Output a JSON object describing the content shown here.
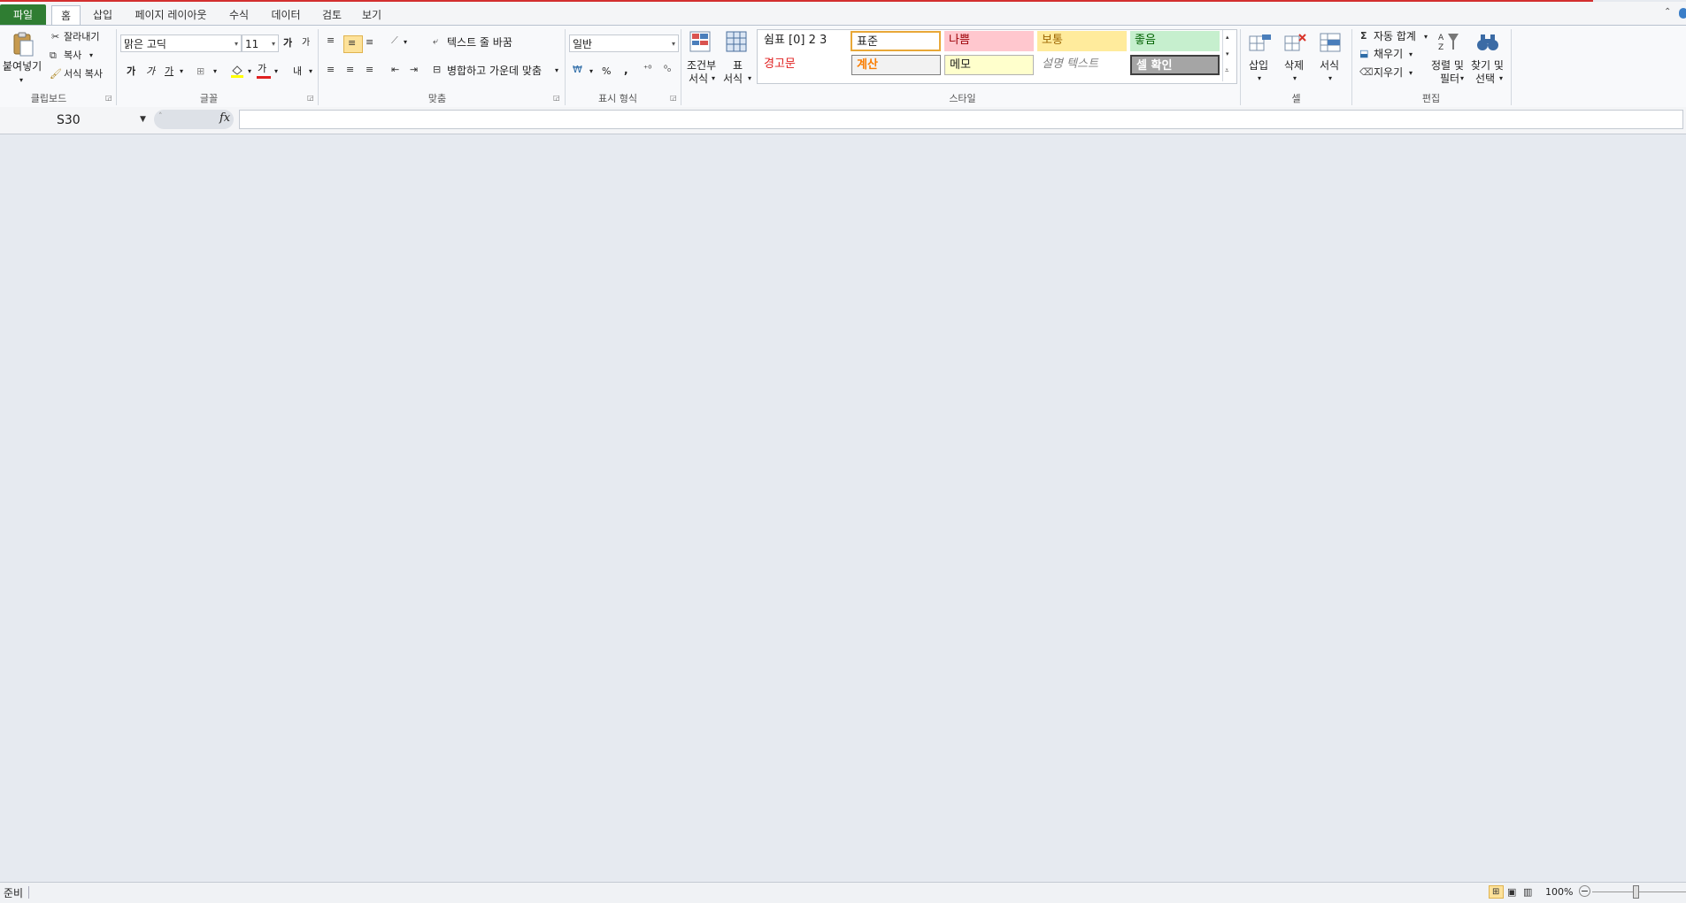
{
  "tabs": {
    "file": "파일",
    "home": "홈",
    "insert": "삽입",
    "page_layout": "페이지 레이아웃",
    "formulas": "수식",
    "data": "데이터",
    "review": "검토",
    "view": "보기"
  },
  "clipboard": {
    "paste": "붙여넣기",
    "cut": "잘라내기",
    "copy": "복사",
    "format_painter": "서식 복사",
    "group_label": "클립보드"
  },
  "font": {
    "name": "맑은 고딕",
    "size": "11",
    "grow": "가",
    "shrink": "가",
    "bold": "가",
    "italic": "가",
    "underline": "가",
    "font_color_glyph": "가",
    "phonetic_glyph": "내",
    "group_label": "글꼴"
  },
  "alignment": {
    "wrap_text": "텍스트 줄 바꿈",
    "merge_center": "병합하고 가운데 맞춤",
    "group_label": "맞춤"
  },
  "number": {
    "format": "일반",
    "percent": "%",
    "comma": ",",
    "group_label": "표시 형식"
  },
  "styles": {
    "conditional_line1": "조건부",
    "conditional_line2": "서식",
    "table_line1": "표",
    "table_line2": "서식",
    "comma0": "쉼표 [0] 2 3",
    "normal": "표준",
    "bad": "나쁨",
    "neutral": "보통",
    "good": "좋음",
    "warning": "경고문",
    "calculation": "계산",
    "note": "메모",
    "explanatory": "설명 텍스트",
    "check_cell": "셀 확인",
    "group_label": "스타일"
  },
  "cells": {
    "insert": "삽입",
    "delete": "삭제",
    "format": "서식",
    "group_label": "셀"
  },
  "editing": {
    "autosum": "자동 합계",
    "fill": "채우기",
    "clear": "지우기",
    "sort_line1": "정렬 및",
    "sort_line2": "필터",
    "find_line1": "찾기 및",
    "find_line2": "선택",
    "group_label": "편집"
  },
  "formula_bar": {
    "name_box": "S30",
    "fx": "fx"
  },
  "status": {
    "ready": "준비",
    "zoom": "100%"
  },
  "colors": {
    "file_tab": "#2f7d32",
    "top_accent": "#d32f2f",
    "bad_bg": "#ffc7ce",
    "neutral_bg": "#ffeb9c",
    "good_bg": "#c6efce",
    "check_bg": "#a5a5a5"
  }
}
